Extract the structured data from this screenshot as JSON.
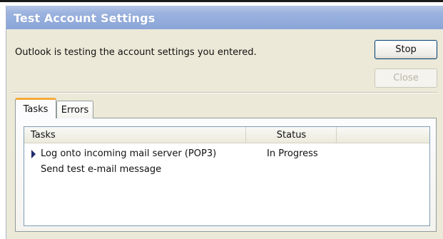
{
  "window": {
    "title": "Test Account Settings"
  },
  "message": "Outlook is testing the account settings you entered.",
  "buttons": {
    "stop": "Stop",
    "close": "Close"
  },
  "tabs": [
    {
      "label": "Tasks",
      "active": true
    },
    {
      "label": "Errors",
      "active": false
    }
  ],
  "list": {
    "columns": {
      "tasks": "Tasks",
      "status": "Status"
    },
    "rows": [
      {
        "name": "Log onto incoming mail server (POP3)",
        "status": "In Progress",
        "current": true
      },
      {
        "name": "Send test e-mail message",
        "status": "",
        "current": false
      }
    ]
  },
  "colors": {
    "title_bar": "#8aa5d8",
    "dialog_bg": "#ece9d8",
    "active_tab_accent": "#f7a93b",
    "current_task_arrow": "#1f2a6e"
  },
  "icons": {
    "current_task": "play-arrow-icon"
  }
}
